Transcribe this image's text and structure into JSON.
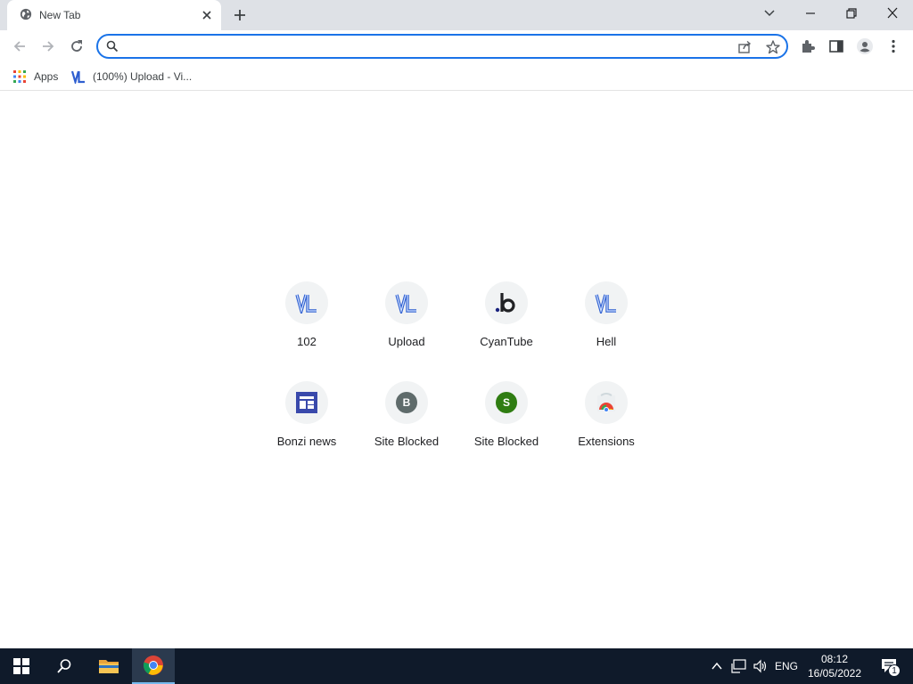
{
  "window": {
    "tab_title": "New Tab",
    "tab_favicon": "globe-icon",
    "controls": [
      "tab-search-icon",
      "minimize-icon",
      "restore-icon",
      "close-icon"
    ]
  },
  "toolbar": {
    "omnibox_value": "",
    "omnibox_placeholder": ""
  },
  "bookmarks": [
    {
      "label": "Apps",
      "icon": "apps-grid-icon"
    },
    {
      "label": "(100%) Upload - Vi...",
      "icon": "vl-icon"
    }
  ],
  "shortcuts": [
    {
      "label": "102",
      "icon": "vl-icon"
    },
    {
      "label": "Upload",
      "icon": "vl-icon"
    },
    {
      "label": "CyanTube",
      "icon": "b-logo-icon"
    },
    {
      "label": "Hell",
      "icon": "vl-icon"
    },
    {
      "label": "Bonzi news",
      "icon": "news-icon"
    },
    {
      "label": "Site Blocked",
      "icon": "letter-b-icon",
      "letter": "B",
      "color": "#5f6b6b"
    },
    {
      "label": "Site Blocked",
      "icon": "letter-s-icon",
      "letter": "S",
      "color": "#2f7d12"
    },
    {
      "label": "Extensions",
      "icon": "chrome-webstore-icon"
    }
  ],
  "taskbar": {
    "language": "ENG",
    "time": "08:12",
    "date": "16/05/2022",
    "notification_count": "1"
  },
  "colors": {
    "accent": "#1a73e8",
    "titlebar": "#dee1e6",
    "taskbar": "#0f1a2a"
  }
}
